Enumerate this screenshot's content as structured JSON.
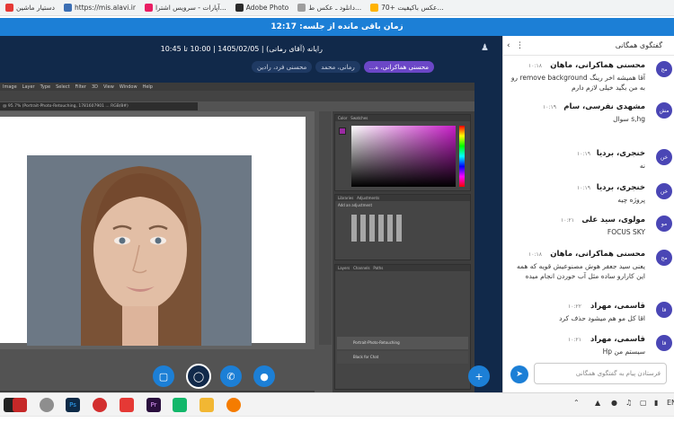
{
  "bookmarks": [
    {
      "label": "دستیار ماشین"
    },
    {
      "label": "https://mis.alavi.ir"
    },
    {
      "label": "آپارات - سرویس اشترا..."
    },
    {
      "label": "Adobe Photo"
    },
    {
      "label": "دانلود ـ عکس ط..."
    },
    {
      "label": "70+ عکس باکیفیت..."
    }
  ],
  "banner": {
    "text": "زمان باقی مانده از جلسه: 12:17"
  },
  "meeting": {
    "title": "رایانه (آقای رمانی) | 1405/02/05 | 10:00 تا 10:45",
    "pills": [
      {
        "label": "محسنی هماکرانی، ه...",
        "active": true
      },
      {
        "label": "رمانی، محمد",
        "active": false
      },
      {
        "label": "محسنی فرد، رادین",
        "active": false
      }
    ]
  },
  "photoshop": {
    "menu": [
      "Image",
      "Layer",
      "Type",
      "Select",
      "Filter",
      "3D",
      "View",
      "Window",
      "Help"
    ],
    "doc_tab": "@ 95.7% (Portrait-Photo-Retouching, 1781607901 ... RGB/8#)",
    "panels": {
      "color": "Color",
      "swatches": "Swatches",
      "adjustments": "Adjustments",
      "libraries": "Libraries",
      "layers": "Layers",
      "channels": "Channels",
      "paths": "Paths",
      "add_adjustment": "Add an adjustment"
    },
    "layers": [
      {
        "name": "Portrait-Photo-Retouching"
      },
      {
        "name": "Black for Chat"
      }
    ]
  },
  "chat": {
    "header": "گفتگوی همگانی",
    "messages": [
      {
        "avatar": "مح",
        "name": "محسنی هماکرانی، ماهان",
        "time": "۱۰:۱۸",
        "text": "آقا همیشه اخر رینگ remove background رو به من بگید خیلی لازم دارم",
        "ltr": false
      },
      {
        "avatar": "مش",
        "name": "مشهدی نفرسی، سام",
        "time": "۱۰:۱۹",
        "text": "s,hg سوال",
        "ltr": false
      },
      {
        "avatar": "خن",
        "name": "خنجری، بردیا",
        "time": "۱۰:۱۹",
        "text": "نه",
        "ltr": false
      },
      {
        "avatar": "خن",
        "name": "خنجری، بردیا",
        "time": "۱۰:۱۹",
        "text": "پروژه چیه",
        "ltr": false
      },
      {
        "avatar": "مو",
        "name": "مولوی، سید علی",
        "time": "۱۰:۲۱",
        "text": "FOCUS SKY",
        "ltr": true
      },
      {
        "avatar": "مح",
        "name": "محسنی هماکرانی، ماهان",
        "time": "۱۰:۱۸",
        "text": "یعنی سید جعفر هوش مصنوعیش قویه که همه این کارارو ساده مثل آب خوردن انجام میده",
        "ltr": false
      },
      {
        "avatar": "قا",
        "name": "قاسمی، مهراد",
        "time": "۱۰:۲۲",
        "text": "اقا کل مو هم میشود حذف کرد",
        "ltr": false
      },
      {
        "avatar": "قا",
        "name": "قاسمی، مهراد",
        "time": "۱۰:۲۱",
        "text": "سیستم من Hp",
        "ltr": false
      }
    ],
    "input_placeholder": "فرستادن پیام به گفتگوی همگانی"
  },
  "taskbar": {
    "tray_time": "EN"
  },
  "colors": {
    "accent": "#1c7fd6",
    "meeting_bg": "#11294a",
    "pill_active": "#6b47c7",
    "avatar": "#4a46b5"
  }
}
